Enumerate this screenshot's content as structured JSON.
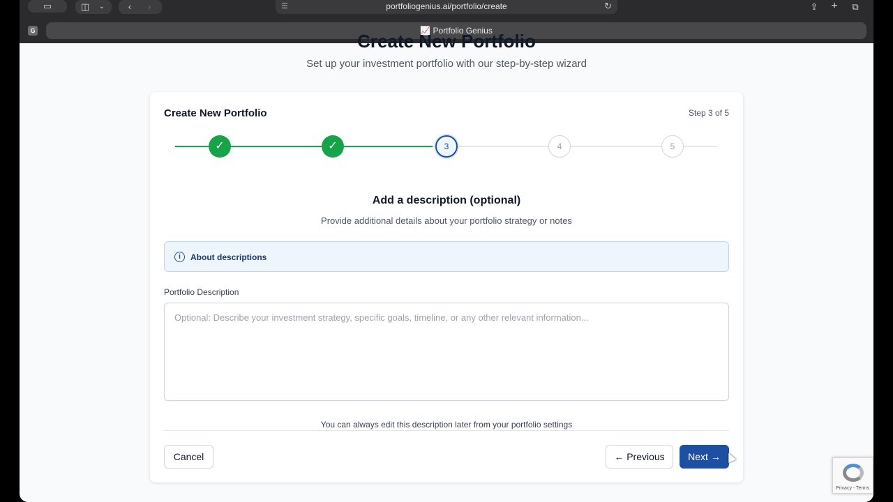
{
  "browser": {
    "url": "portfoliogenius.ai/portfolio/create",
    "tab_title": "Portfolio Genius",
    "tab_favicon": "chart-emoji-icon",
    "profile_badge": "G"
  },
  "page": {
    "title": "Create New Portfolio",
    "subtitle": "Set up your investment portfolio with our step-by-step wizard"
  },
  "wizard": {
    "title": "Create New Portfolio",
    "step_indicator": "Step 3 of 5",
    "steps": [
      {
        "label": "✓",
        "state": "done"
      },
      {
        "label": "✓",
        "state": "done"
      },
      {
        "label": "3",
        "state": "current"
      },
      {
        "label": "4",
        "state": "pending"
      },
      {
        "label": "5",
        "state": "pending"
      }
    ],
    "section_title": "Add a description (optional)",
    "section_subtitle": "Provide additional details about your portfolio strategy or notes",
    "info_label": "About descriptions",
    "field_label": "Portfolio Description",
    "field_placeholder": "Optional: Describe your investment strategy, specific goals, timeline, or any other relevant information...",
    "field_value": "",
    "help_text": "You can always edit this description later from your portfolio settings",
    "cancel_label": "Cancel",
    "previous_label": "← Previous",
    "next_label": "Next →"
  },
  "recaptcha": {
    "terms": "Privacy - Terms"
  },
  "colors": {
    "primary": "#1e4fa3",
    "success": "#16a34a",
    "info_bg": "#eef5fd"
  }
}
